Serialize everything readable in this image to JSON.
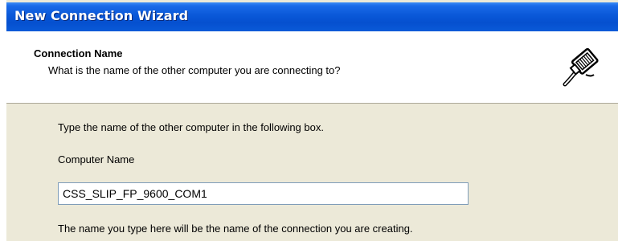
{
  "window": {
    "title": "New Connection Wizard"
  },
  "header": {
    "title": "Connection Name",
    "subtitle": "What is the name of the other computer you are connecting to?",
    "icon": "network-cable-icon"
  },
  "content": {
    "instruction": "Type the name of the other computer in the following box.",
    "field_label": "Computer Name",
    "computer_name_value": "CSS_SLIP_FP_9600_COM1",
    "note": "The name you type here will be the name of the connection you are creating."
  }
}
